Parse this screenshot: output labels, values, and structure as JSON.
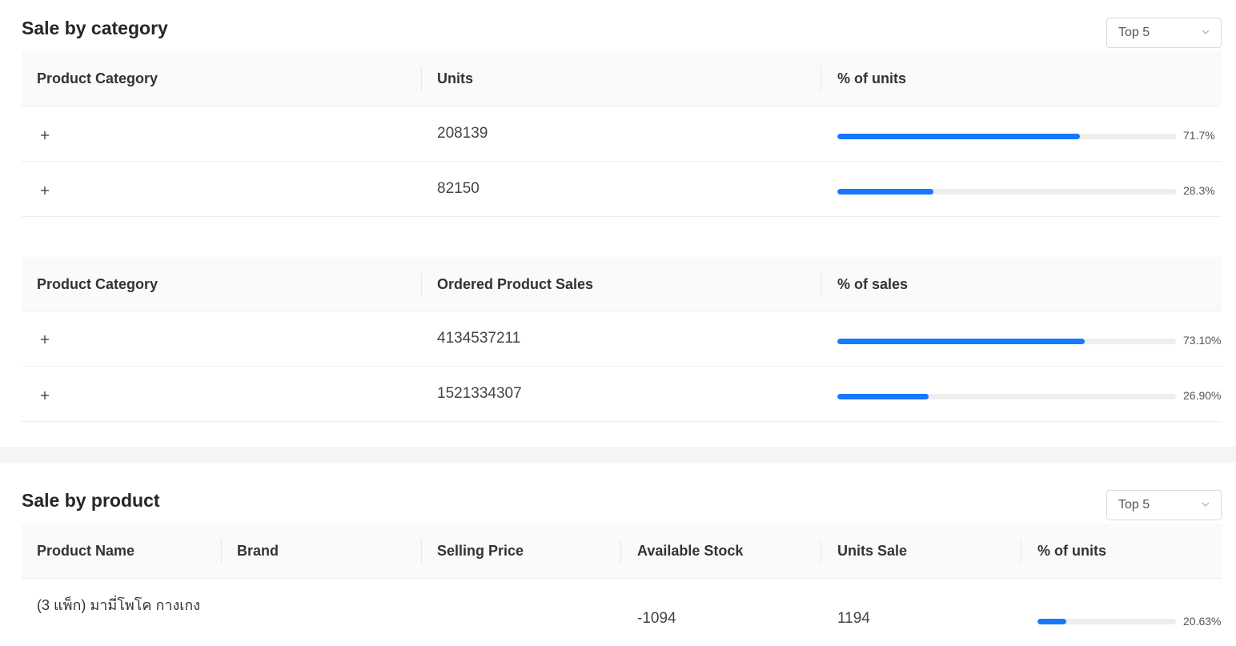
{
  "category_section": {
    "title": "Sale by category",
    "top_select": "Top 5",
    "units_table": {
      "headers": [
        "Product Category",
        "Units",
        "% of units"
      ],
      "rows": [
        {
          "category": "",
          "units": "208139",
          "percent_label": "71.7%",
          "percent": 71.7
        },
        {
          "category": "",
          "units": "82150",
          "percent_label": "28.3%",
          "percent": 28.3
        }
      ]
    },
    "sales_table": {
      "headers": [
        "Product Category",
        "Ordered Product Sales",
        "% of sales"
      ],
      "rows": [
        {
          "category": "",
          "sales": "4134537211",
          "percent_label": "73.10%",
          "percent": 73.1
        },
        {
          "category": "",
          "sales": "1521334307",
          "percent_label": "26.90%",
          "percent": 26.9
        }
      ]
    }
  },
  "product_section": {
    "title": "Sale by product",
    "top_select": "Top 5",
    "headers": [
      "Product Name",
      "Brand",
      "Selling Price",
      "Available Stock",
      "Units Sale",
      "% of units"
    ],
    "rows": [
      {
        "name": "(3 แพ็ก) มามี่โพโค กางเกง",
        "brand": "",
        "price": "",
        "stock": "-1094",
        "units": "1194",
        "percent_label": "20.63%",
        "percent": 20.63
      }
    ]
  },
  "icons": {
    "expand": "plus-icon",
    "dropdown": "chevron-down-icon"
  },
  "colors": {
    "accent": "#1677ff",
    "track": "#eeeeee"
  }
}
